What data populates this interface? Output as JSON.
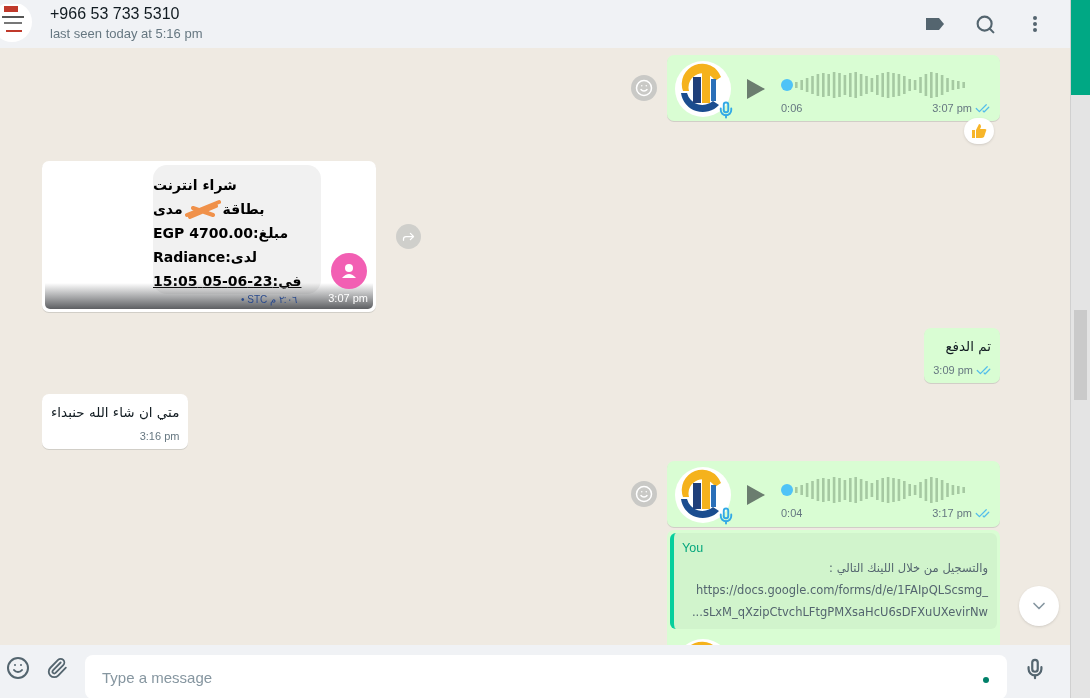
{
  "header": {
    "title": "+966 53 733 5310",
    "status": "last seen today at 5:16 pm"
  },
  "messages": [
    {
      "kind": "voice",
      "outgoing": true,
      "duration": "0:06",
      "time": "3:07 pm",
      "read": true,
      "reaction": true
    },
    {
      "outgoing": false,
      "time": "3:07 pm",
      "forward": true,
      "sms": {
        "line_1": "شراء انترنت",
        "line_2_start": "بطاقة",
        "line_2_end": "مدى",
        "line_3": "مبلغ:EGP 4700.00",
        "line_4": "لدى:Radiance",
        "line_5": "في:23-06-05 15:05",
        "caption": "٢:٠٦ م STC •"
      }
    },
    {
      "kind": "text",
      "outgoing": true,
      "text": "تم الدفع",
      "time": "3:09 pm",
      "read": true
    },
    {
      "kind": "text",
      "outgoing": false,
      "text": "متي ان شاء الله حنبداء",
      "time": "3:16 pm"
    },
    {
      "kind": "voice",
      "outgoing": true,
      "duration": "0:04",
      "time": "3:17 pm",
      "read": true,
      "reaction": false
    },
    {
      "kind": "reply",
      "outgoing": true,
      "quote_author": "You",
      "quote_lines": [
        "والتسجيل من خلال اللينك التالي :",
        "https://docs.google.com/forms/d/e/1FAIpQLScsmg_",
        "...sLxM_qXzipCtvchLFtgPMXsaHcU6sDFXuUXevirNw"
      ]
    }
  ],
  "composer": {
    "placeholder": "Type a message"
  }
}
